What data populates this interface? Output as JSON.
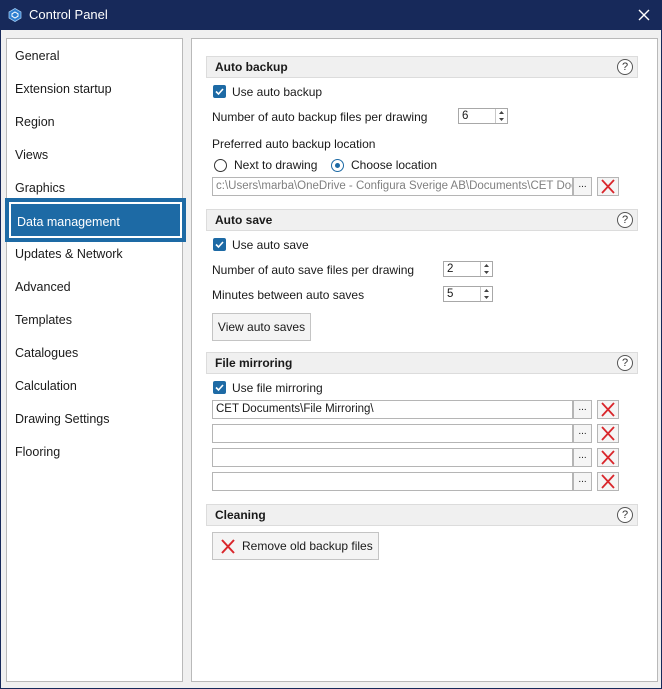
{
  "window": {
    "title": "Control Panel"
  },
  "sidebar": {
    "items": [
      {
        "label": "General"
      },
      {
        "label": "Extension startup"
      },
      {
        "label": "Region"
      },
      {
        "label": "Views"
      },
      {
        "label": "Graphics"
      },
      {
        "label": "Data management",
        "active": true
      },
      {
        "label": "Updates & Network"
      },
      {
        "label": "Advanced"
      },
      {
        "label": "Templates"
      },
      {
        "label": "Catalogues"
      },
      {
        "label": "Calculation"
      },
      {
        "label": "Drawing Settings"
      },
      {
        "label": "Flooring"
      }
    ]
  },
  "auto_backup": {
    "title": "Auto backup",
    "use_label": "Use auto backup",
    "use_checked": true,
    "files_label": "Number of auto backup files per drawing",
    "files_value": "6",
    "location_label": "Preferred auto backup location",
    "option_next": "Next to drawing",
    "option_choose": "Choose location",
    "selected_option": "Choose location",
    "path": "c:\\Users\\marba\\OneDrive - Configura Sverige AB\\Documents\\CET Documents\\",
    "browse_label": "..."
  },
  "auto_save": {
    "title": "Auto save",
    "use_label": "Use auto save",
    "use_checked": true,
    "files_label": "Number of auto save files per drawing",
    "files_value": "2",
    "minutes_label": "Minutes between auto saves",
    "minutes_value": "5",
    "view_button": "View auto saves"
  },
  "file_mirroring": {
    "title": "File mirroring",
    "use_label": "Use file mirroring",
    "use_checked": true,
    "paths": [
      "CET Documents\\File Mirroring\\",
      "",
      "",
      ""
    ],
    "browse_label": "..."
  },
  "cleaning": {
    "title": "Cleaning",
    "remove_button": "Remove old backup files"
  },
  "help_label": "?",
  "colors": {
    "titlebar": "#17295a",
    "accent": "#1d6aa5",
    "delete": "#d9262b"
  }
}
